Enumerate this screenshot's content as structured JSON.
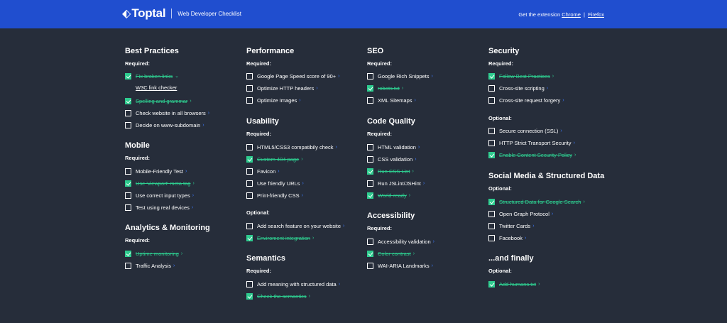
{
  "header": {
    "logo": "Toptal",
    "subtitle": "Web Developer Checklist",
    "ext_prefix": "Get the extension",
    "chrome": "Chrome",
    "separator": "|",
    "firefox": "Firefox"
  },
  "colors": {
    "header": "#204ecf",
    "background": "#262d3a",
    "checked": "#2ecc8f",
    "link": "#3d7bff"
  },
  "icons": {
    "logo": "toptal-logo-icon",
    "chevron": "chevron-right-icon",
    "check": "check-icon"
  },
  "col1": {
    "best_practices": {
      "title": "Best Practices",
      "required": "Required:",
      "items": [
        {
          "label": "Fix broken links",
          "checked": true,
          "arrow": "⌄"
        },
        {
          "label": "Spelling and grammar",
          "checked": true,
          "arrow": "›"
        },
        {
          "label": "Check website in all browsers",
          "checked": false,
          "arrow": "›"
        },
        {
          "label": "Decide on www-subdomain",
          "checked": false,
          "arrow": "›"
        }
      ],
      "sublink": "W3C link checker"
    },
    "mobile": {
      "title": "Mobile",
      "required": "Required:",
      "items": [
        {
          "label": "Mobile-Friendly Test",
          "checked": false
        },
        {
          "label": "Use 'viewport' meta tag",
          "checked": true
        },
        {
          "label": "Use correct input types",
          "checked": false
        },
        {
          "label": "Test using real devices",
          "checked": false
        }
      ]
    },
    "analytics": {
      "title": "Analytics & Monitoring",
      "required": "Required:",
      "items": [
        {
          "label": "Uptime monitoring",
          "checked": true
        },
        {
          "label": "Traffic Analysis",
          "checked": false
        }
      ]
    }
  },
  "col2": {
    "performance": {
      "title": "Performance",
      "required": "Required:",
      "items": [
        {
          "label": "Google Page Speed score of 90+",
          "checked": false
        },
        {
          "label": "Optimize HTTP headers",
          "checked": false
        },
        {
          "label": "Optimize Images",
          "checked": false
        }
      ]
    },
    "usability": {
      "title": "Usability",
      "required": "Required:",
      "items": [
        {
          "label": "HTML5/CSS3 compatibily check",
          "checked": false
        },
        {
          "label": "Custom 404 page",
          "checked": true
        },
        {
          "label": "Favicon",
          "checked": false
        },
        {
          "label": "Use friendly URLs",
          "checked": false
        },
        {
          "label": "Print-friendly CSS",
          "checked": false
        }
      ],
      "optional": "Optional:",
      "optional_items": [
        {
          "label": "Add search feature on your website",
          "checked": false
        },
        {
          "label": "Enviroment integration",
          "checked": true
        }
      ]
    },
    "semantics": {
      "title": "Semantics",
      "required": "Required:",
      "items": [
        {
          "label": "Add meaning with structured data",
          "checked": false
        },
        {
          "label": "Check the semantics",
          "checked": true
        }
      ]
    }
  },
  "col3": {
    "seo": {
      "title": "SEO",
      "required": "Required:",
      "items": [
        {
          "label": "Google Rich Snippets",
          "checked": false
        },
        {
          "label": "robots.txt",
          "checked": true
        },
        {
          "label": "XML Sitemaps",
          "checked": false
        }
      ]
    },
    "code_quality": {
      "title": "Code Quality",
      "required": "Required:",
      "items": [
        {
          "label": "HTML validation",
          "checked": false
        },
        {
          "label": "CSS validation",
          "checked": false
        },
        {
          "label": "Run CSS Lint",
          "checked": true
        },
        {
          "label": "Run JSLint/JSHint",
          "checked": false
        },
        {
          "label": "World-ready",
          "checked": true
        }
      ]
    },
    "accessibility": {
      "title": "Accessibility",
      "required": "Required:",
      "items": [
        {
          "label": "Accessibility validation",
          "checked": false
        },
        {
          "label": "Color contrast",
          "checked": true
        },
        {
          "label": "WAI-ARIA Landmarks",
          "checked": false
        }
      ]
    }
  },
  "col4": {
    "security": {
      "title": "Security",
      "required": "Required:",
      "items": [
        {
          "label": "Follow Best Practices",
          "checked": true
        },
        {
          "label": "Cross-site scripting",
          "checked": false
        },
        {
          "label": "Cross-site request forgery",
          "checked": false
        }
      ],
      "optional": "Optional:",
      "optional_items": [
        {
          "label": "Secure connection (SSL)",
          "checked": false
        },
        {
          "label": "HTTP Strict Transport Security",
          "checked": false
        },
        {
          "label": "Enable Content Security Policy",
          "checked": true
        }
      ]
    },
    "social": {
      "title": "Social Media & Structured Data",
      "optional": "Optional:",
      "items": [
        {
          "label": "Structured Data for Google Search",
          "checked": true
        },
        {
          "label": "Open Graph Protocol",
          "checked": false
        },
        {
          "label": "Twitter Cards",
          "checked": false
        },
        {
          "label": "Facebook",
          "checked": false
        }
      ]
    },
    "finally": {
      "title": "...and finally",
      "optional": "Optional:",
      "items": [
        {
          "label": "Add humans.txt",
          "checked": true
        }
      ]
    }
  }
}
